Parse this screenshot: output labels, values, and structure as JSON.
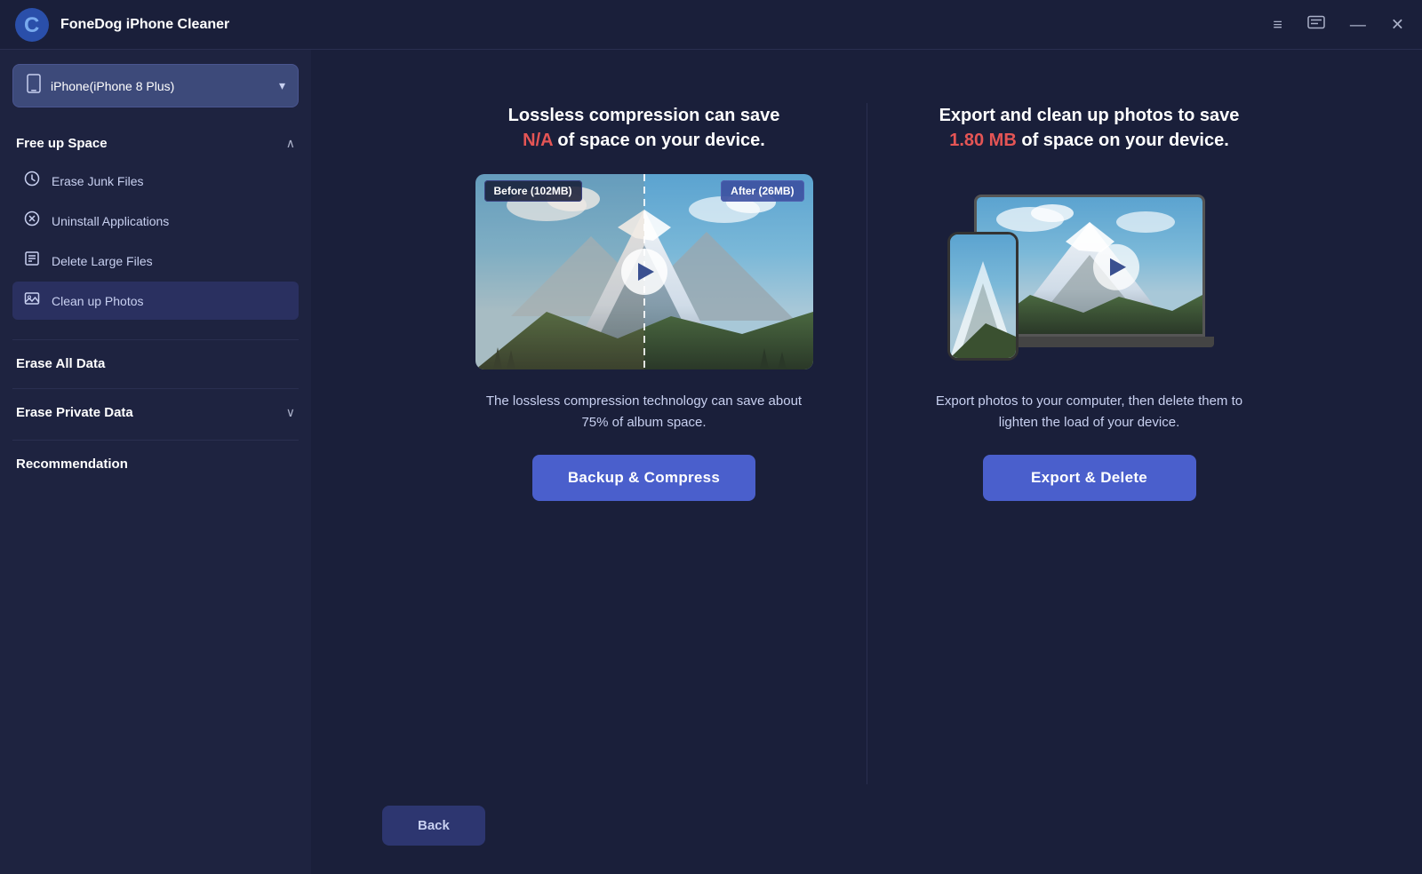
{
  "app": {
    "title": "FoneDog iPhone Cleaner",
    "logo_letter": "C"
  },
  "titlebar": {
    "menu_icon": "≡",
    "chat_icon": "☐",
    "minimize_icon": "—",
    "close_icon": "✕"
  },
  "device_selector": {
    "name": "iPhone(iPhone 8 Plus)",
    "icon": "📱"
  },
  "sidebar": {
    "free_space": {
      "title": "Free up Space",
      "expanded": true,
      "items": [
        {
          "label": "Erase Junk Files",
          "icon": "⏱"
        },
        {
          "label": "Uninstall Applications",
          "icon": "⊗"
        },
        {
          "label": "Delete Large Files",
          "icon": "▤"
        },
        {
          "label": "Clean up Photos",
          "icon": "🖼"
        }
      ]
    },
    "erase_all": {
      "title": "Erase All Data"
    },
    "erase_private": {
      "title": "Erase Private Data",
      "expanded": false
    },
    "recommendation": {
      "title": "Recommendation"
    }
  },
  "left_card": {
    "headline_part1": "Lossless compression can save",
    "headline_highlight": "N/A",
    "headline_part2": "of space on your device.",
    "before_label": "Before (102MB)",
    "after_label": "After (26MB)",
    "description": "The lossless compression technology can save about 75% of album space.",
    "button_label": "Backup & Compress"
  },
  "right_card": {
    "headline_part1": "Export and clean up photos to save",
    "headline_highlight": "1.80 MB",
    "headline_part2": "of space on your device.",
    "description": "Export photos to your computer, then delete them to lighten the load of your device.",
    "button_label": "Export & Delete"
  },
  "bottom": {
    "back_label": "Back"
  },
  "colors": {
    "highlight_red": "#e55555",
    "button_blue": "#4a5fcc",
    "sidebar_bg": "#1e2340",
    "app_bg": "#1a1f3a",
    "device_selector_bg": "#3d4a7a"
  }
}
